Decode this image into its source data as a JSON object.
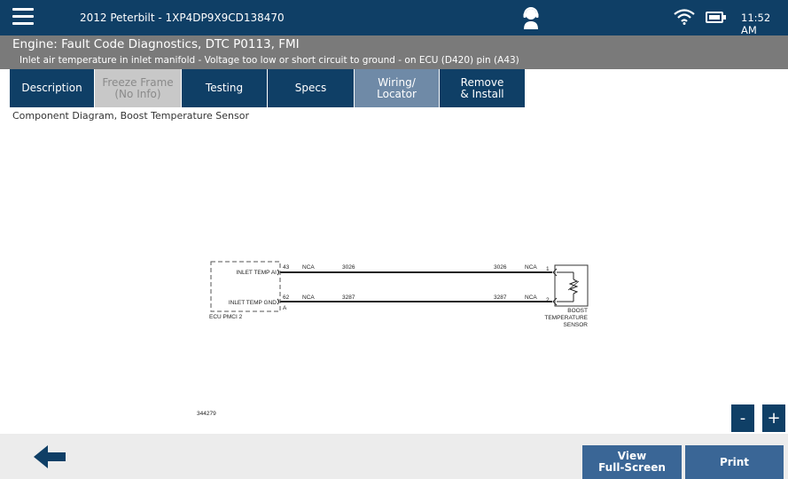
{
  "topbar": {
    "vehicle": "2012 Peterbilt - 1XP4DP9X9CD138470",
    "time": "11:52 AM"
  },
  "fault": {
    "title": "Engine: Fault Code Diagnostics, DTC P0113, FMI",
    "description": "Inlet air temperature in inlet manifold - Voltage too low or short circuit to ground - on ECU (D420) pin (A43)"
  },
  "tabs": [
    {
      "label": "Description",
      "state": "normal"
    },
    {
      "label": "Freeze Frame\n(No Info)",
      "state": "disabled"
    },
    {
      "label": "Testing",
      "state": "normal"
    },
    {
      "label": "Specs",
      "state": "normal"
    },
    {
      "label": "Wiring/\nLocator",
      "state": "active"
    },
    {
      "label": "Remove\n& Install",
      "state": "normal"
    }
  ],
  "section_label": "Component Diagram, Boost Temperature Sensor",
  "diagram": {
    "ecu_label": "ECU PMCI 2",
    "pin_row_a": {
      "name": "INLET TEMP AI",
      "pin": "43",
      "code": "NCA",
      "wire_left": "3026",
      "wire_right": "3026",
      "code_right": "NCA",
      "sensor_pin": "1"
    },
    "pin_row_b": {
      "name": "INLET TEMP GND",
      "pin": "62",
      "code": "NCA",
      "wire_left": "3287",
      "wire_right": "3287",
      "code_right": "NCA",
      "sensor_pin": "2"
    },
    "connector_letter": "A",
    "sensor_label_1": "BOOST",
    "sensor_label_2": "TEMPERATURE",
    "sensor_label_3": "SENSOR",
    "figure_number": "344279"
  },
  "zoom": {
    "minus": "-",
    "plus": "+"
  },
  "footer": {
    "view_fullscreen": "View\nFull-Screen",
    "print": "Print"
  },
  "colors": {
    "navy": "#0f3f66",
    "active_tab": "#6f8aa7",
    "footer_button": "#3a6696",
    "header_gray": "#7a7a7a"
  }
}
